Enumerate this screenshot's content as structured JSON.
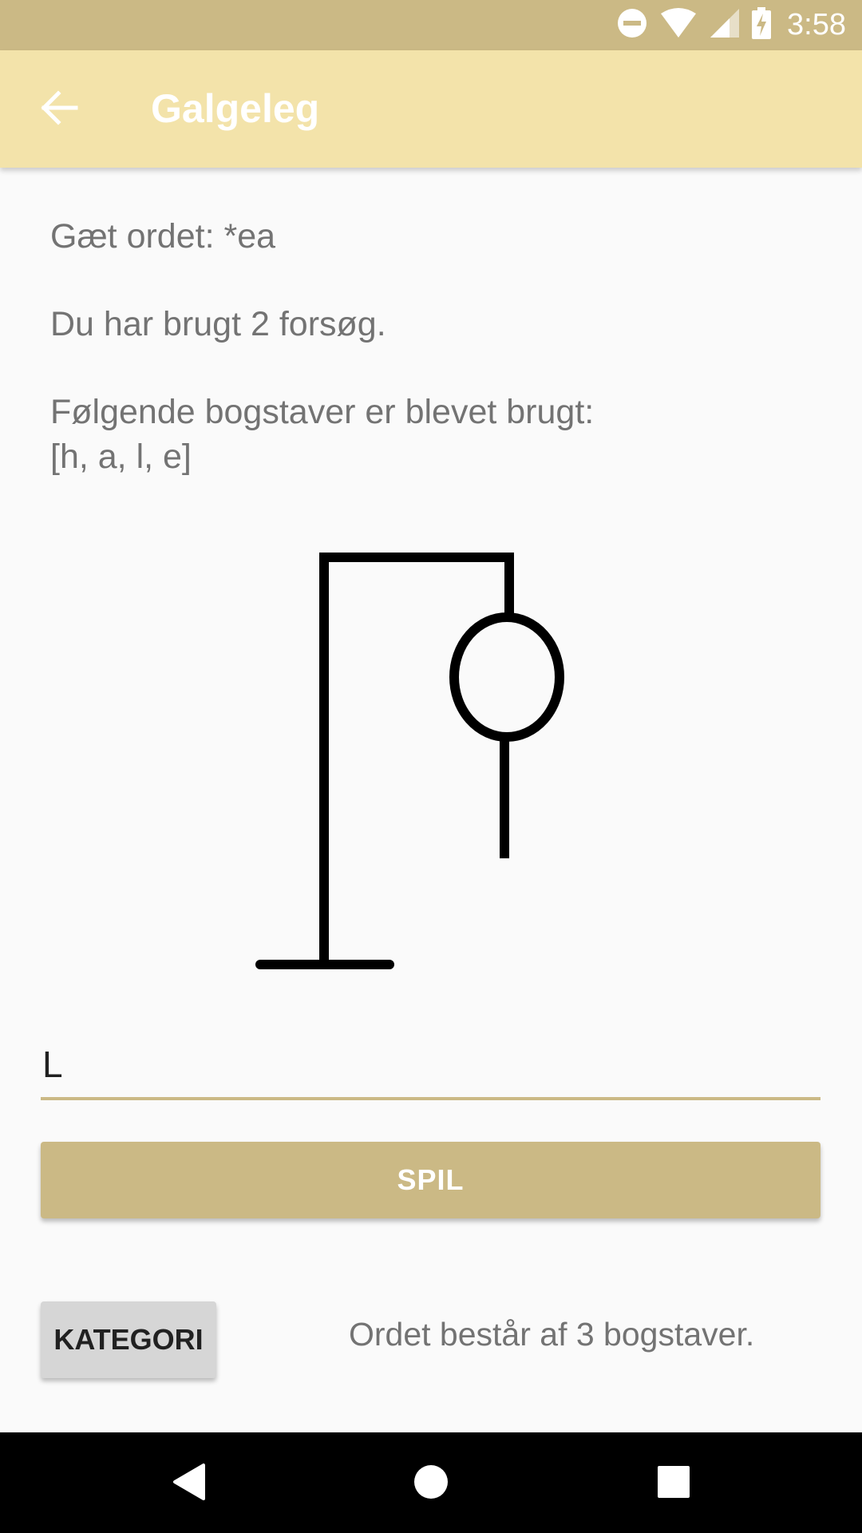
{
  "status_bar": {
    "time": "3:58",
    "icons": [
      "do-not-disturb-icon",
      "wifi-icon",
      "cell-signal-icon",
      "battery-charging-icon"
    ]
  },
  "app_bar": {
    "title": "Galgeleg",
    "back_icon": "arrow-back-icon"
  },
  "game": {
    "guess_word": "Gæt ordet: *ea",
    "attempts": "Du har brugt 2 forsøg.",
    "used_letters_label": "Følgende bogstaver er blevet brugt:",
    "used_letters": "[h, a, l, e]"
  },
  "input": {
    "value": "L"
  },
  "buttons": {
    "play": "SPIL",
    "category": "KATEGORI"
  },
  "word_length": "Ordet består af 3 bogstaver.",
  "colors": {
    "status_bar": "#cbb985",
    "app_bar": "#f3e3aa",
    "accent": "#cbb985",
    "text_secondary": "#737373"
  }
}
